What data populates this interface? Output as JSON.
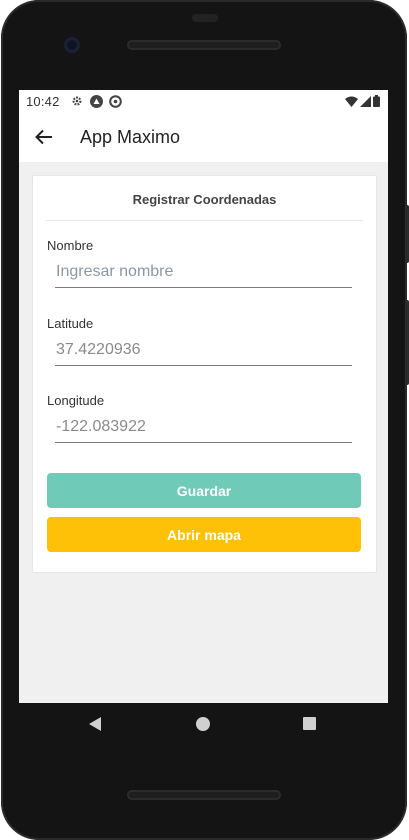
{
  "status_bar": {
    "time": "10:42",
    "icons": [
      "gear-icon",
      "android-icon",
      "no-sync-icon",
      "wifi-icon",
      "signal-icon",
      "battery-icon"
    ]
  },
  "app_bar": {
    "title": "App Maximo",
    "back_icon": "arrow-left-icon"
  },
  "form": {
    "title": "Registrar Coordenadas",
    "name": {
      "label": "Nombre",
      "value": "",
      "placeholder": "Ingresar nombre"
    },
    "latitude": {
      "label": "Latitude",
      "value": "37.4220936",
      "placeholder": ""
    },
    "longitude": {
      "label": "Longitude",
      "value": "-122.083922",
      "placeholder": ""
    },
    "save_label": "Guardar",
    "open_map_label": "Abrir mapa"
  },
  "colors": {
    "save_button": "#6fcab8",
    "open_map_button": "#ffc107",
    "screen_background": "#f0f0f0",
    "device_frame": "#141414"
  },
  "navigation": {
    "icons": [
      "back-triangle-icon",
      "home-circle-icon",
      "recents-square-icon"
    ]
  }
}
